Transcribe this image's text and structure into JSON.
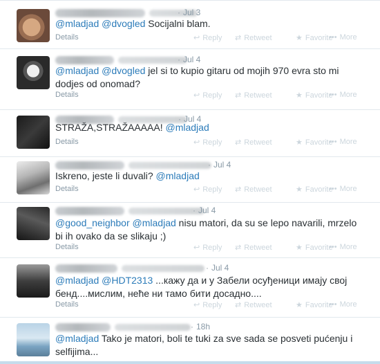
{
  "tweets": [
    {
      "time": "Jul 3",
      "segments": [
        {
          "text": "@mladjad",
          "type": "mention"
        },
        {
          "text": " ",
          "type": "text"
        },
        {
          "text": "@dvogled",
          "type": "mention"
        },
        {
          "text": " Socijalni blam.",
          "type": "text"
        }
      ],
      "details": "Details"
    },
    {
      "time": "Jul 4",
      "segments": [
        {
          "text": "@mladjad",
          "type": "mention"
        },
        {
          "text": " ",
          "type": "text"
        },
        {
          "text": "@dvogled",
          "type": "mention"
        },
        {
          "text": " jel si to kupio gitaru od mojih 970 evra sto mi dodjes od onomad?",
          "type": "text"
        }
      ],
      "details": "Details"
    },
    {
      "time": "Jul 4",
      "segments": [
        {
          "text": "STRAŽA,STRAŽAAAAA! ",
          "type": "text"
        },
        {
          "text": "@mladjad",
          "type": "mention"
        }
      ],
      "details": "Details"
    },
    {
      "time": "Jul 4",
      "segments": [
        {
          "text": "Iskreno, jeste li duvali? ",
          "type": "text"
        },
        {
          "text": "@mladjad",
          "type": "mention"
        }
      ],
      "details": "Details"
    },
    {
      "time": "Jul 4",
      "segments": [
        {
          "text": "@good_neighbor",
          "type": "mention"
        },
        {
          "text": " ",
          "type": "text"
        },
        {
          "text": "@mladjad",
          "type": "mention"
        },
        {
          "text": " nisu matori, da su se lepo navarili, mrzelo bi ih ovako da se slikaju ;)",
          "type": "text"
        }
      ],
      "details": "Details"
    },
    {
      "time": "Jul 4",
      "segments": [
        {
          "text": "@mladjad",
          "type": "mention"
        },
        {
          "text": " ",
          "type": "text"
        },
        {
          "text": "@HDT2313",
          "type": "mention"
        },
        {
          "text": " ...кажу да и у Забели осуђеници имају свој бенд....мислим, неће ни тамо бити досадно....",
          "type": "text"
        }
      ],
      "details": "Details"
    },
    {
      "time": "18h",
      "segments": [
        {
          "text": "@mladjad",
          "type": "mention"
        },
        {
          "text": " Tako je matori, boli te tuki za sve sada se posveti pućenju i selfijima...",
          "type": "text"
        }
      ],
      "details": ""
    }
  ],
  "actions": {
    "reply": "Reply",
    "retweet": "Retweet",
    "favorite": "Favorite",
    "more": "More"
  },
  "icons": {
    "reply": "reply-icon",
    "retweet": "retweet-icon",
    "favorite": "star-icon",
    "more": "ellipsis-icon"
  },
  "separator": "·",
  "colors": {
    "mention": "#2b7bb9",
    "text": "#292f33",
    "meta": "#8899a6",
    "action": "#ccd6dd",
    "border": "#e1e8ed",
    "bottom_strip": "#c6dcec"
  }
}
